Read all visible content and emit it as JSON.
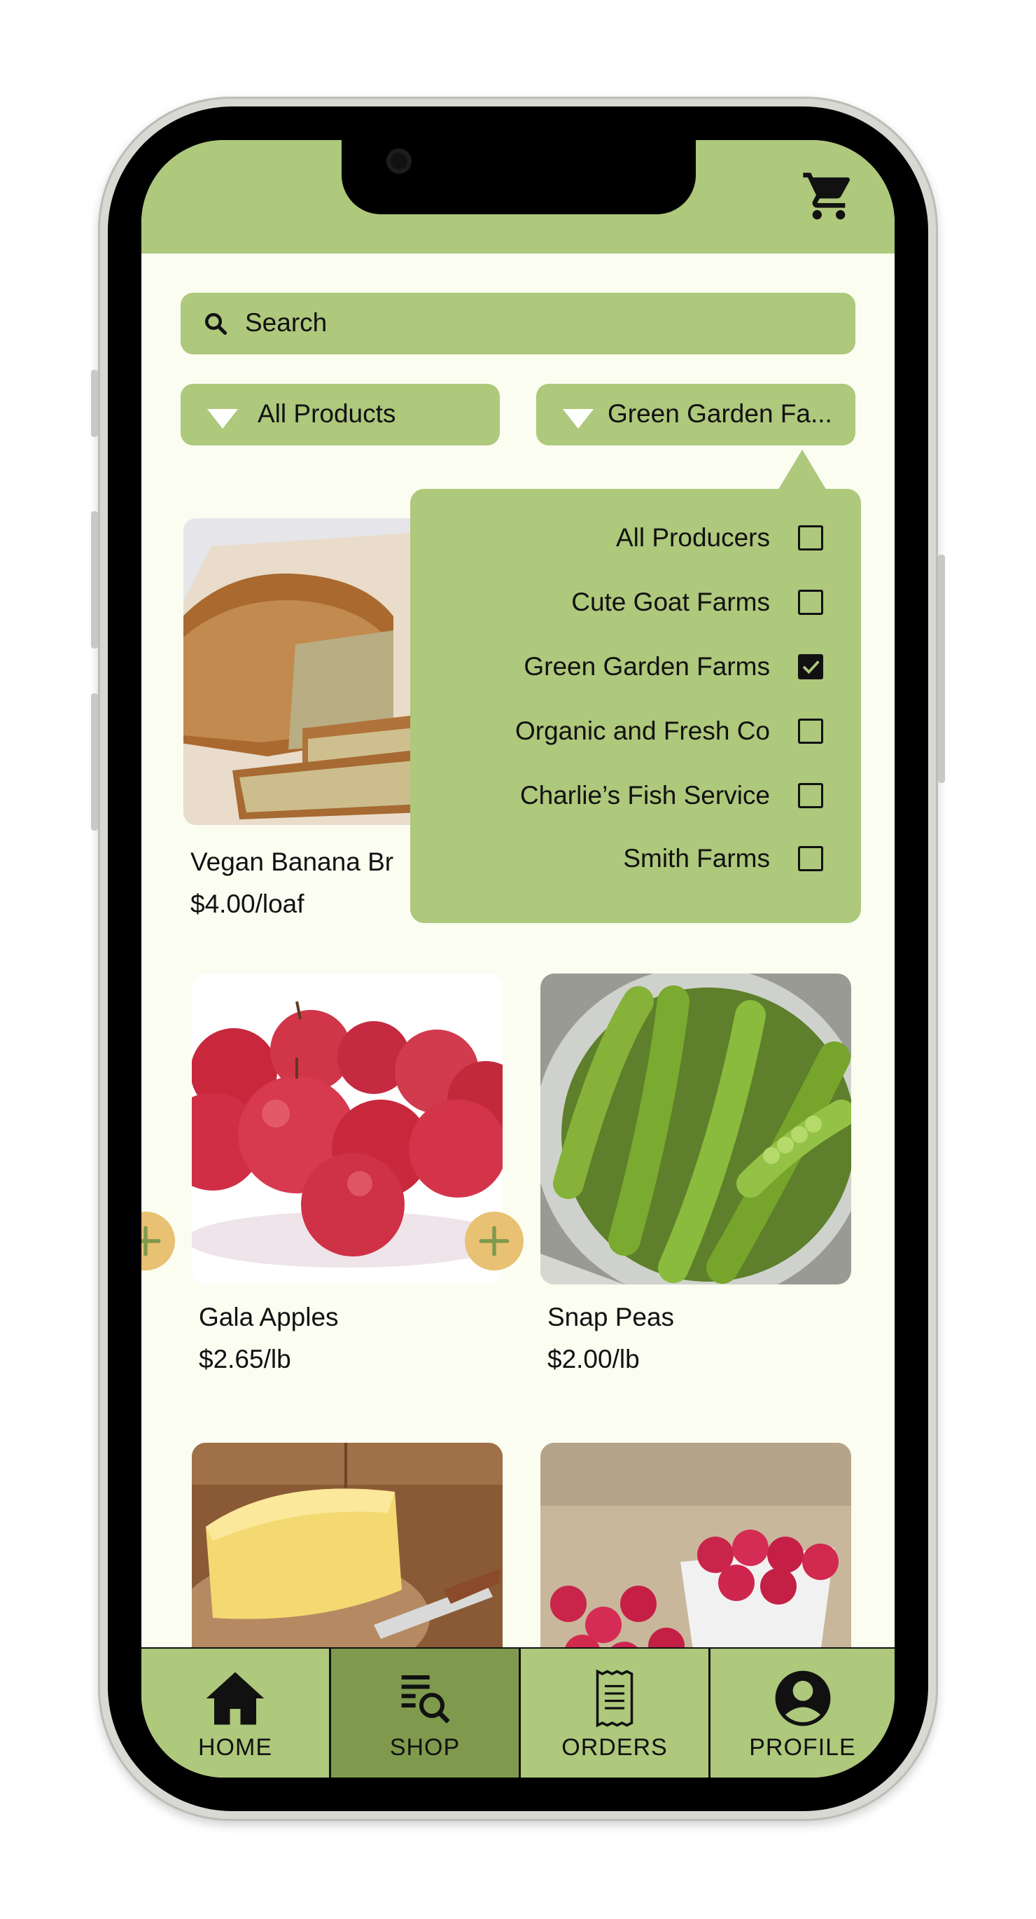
{
  "header": {
    "cart_icon": "shopping-cart-icon"
  },
  "search": {
    "placeholder": "Search",
    "icon": "search-icon"
  },
  "filters": {
    "category": {
      "selected": "All Products"
    },
    "producer": {
      "selected": "Green Garden Fa..."
    }
  },
  "producer_menu": {
    "items": [
      {
        "label": "All Producers",
        "checked": false
      },
      {
        "label": "Cute Goat Farms",
        "checked": false
      },
      {
        "label": "Green Garden Farms",
        "checked": true
      },
      {
        "label": "Organic and Fresh Co",
        "checked": false
      },
      {
        "label": "Charlie’s Fish Service",
        "checked": false
      },
      {
        "label": "Smith Farms",
        "checked": false
      }
    ]
  },
  "products": [
    {
      "name": "Vegan Banana Br",
      "price": "$4.00/loaf",
      "image": "banana-bread"
    },
    {
      "name": "Gala Apples",
      "price": "$2.65/lb",
      "image": "gala-apples"
    },
    {
      "name": "Snap Peas",
      "price": "$2.00/lb",
      "image": "snap-peas"
    },
    {
      "name": "",
      "price": "",
      "image": "butter"
    },
    {
      "name": "",
      "price": "",
      "image": "raspberries"
    }
  ],
  "nav": {
    "items": [
      {
        "label": "HOME",
        "icon": "home-icon",
        "active": false
      },
      {
        "label": "SHOP",
        "icon": "shop-search-icon",
        "active": true
      },
      {
        "label": "ORDERS",
        "icon": "receipt-icon",
        "active": false
      },
      {
        "label": "PROFILE",
        "icon": "profile-icon",
        "active": false
      }
    ]
  },
  "colors": {
    "accent": "#aec87c",
    "accent_active": "#7f9a4d",
    "background": "#fbfdf1",
    "add_button": "#e8c173"
  }
}
